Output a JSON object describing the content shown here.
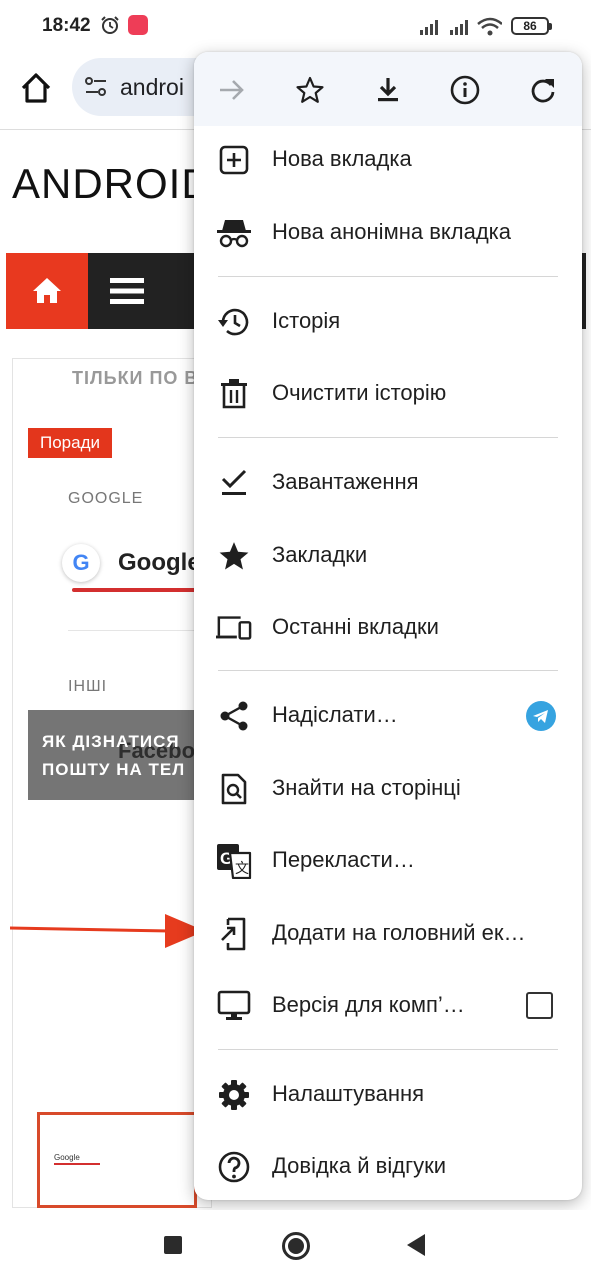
{
  "status_bar": {
    "time": "18:42",
    "battery": "86",
    "icons": [
      "alarm-icon",
      "app-notification-icon",
      "cellular-signal-icon",
      "cellular-signal-icon",
      "wifi-icon",
      "battery-icon"
    ]
  },
  "toolbar": {
    "url_text": "androi",
    "icons": [
      "home-icon",
      "site-settings-icon"
    ]
  },
  "page": {
    "heading": "ANDROID",
    "faded_text": "ТІЛЬКИ ПО В",
    "category_badge": "Поради",
    "google_section_label": "GOOGLE",
    "google_logo_letter": "G",
    "google_name": "Google",
    "other_section_label": "ІНШІ",
    "facebook_name": "Facebo",
    "overlay_title_line1": "ЯК ДІЗНАТИСЯ",
    "overlay_title_line2": "ПОШТУ НА ТЕЛ",
    "thumbnail_label": "Google",
    "nav_icons": [
      "home-icon",
      "hamburger-menu-icon"
    ]
  },
  "menu": {
    "action_row": [
      "forward-arrow-icon",
      "star-icon",
      "download-icon",
      "info-icon",
      "reload-icon"
    ],
    "items": [
      {
        "label": "Нова вкладка",
        "icon": "new-tab-icon"
      },
      {
        "label": "Нова анонімна вкладка",
        "icon": "incognito-icon"
      },
      {
        "label": "Історія",
        "icon": "history-icon"
      },
      {
        "label": "Очистити історію",
        "icon": "trash-icon"
      },
      {
        "label": "Завантаження",
        "icon": "download-check-icon"
      },
      {
        "label": "Закладки",
        "icon": "star-filled-icon"
      },
      {
        "label": "Останні вкладки",
        "icon": "devices-icon"
      },
      {
        "label": "Надіслати…",
        "icon": "share-icon",
        "trailing": "telegram-icon"
      },
      {
        "label": "Знайти на сторінці",
        "icon": "find-in-page-icon"
      },
      {
        "label": "Перекласти…",
        "icon": "translate-icon"
      },
      {
        "label": "Додати на головний ек…",
        "icon": "add-to-home-icon"
      },
      {
        "label": "Версія для комп’…",
        "icon": "desktop-icon",
        "trailing": "checkbox",
        "checked": false
      },
      {
        "label": "Налаштування",
        "icon": "settings-gear-icon"
      },
      {
        "label": "Довідка й відгуки",
        "icon": "help-icon"
      }
    ]
  },
  "nav_bar": {
    "buttons": [
      "recents-button",
      "home-button",
      "back-button"
    ]
  },
  "colors": {
    "accent_red": "#e8391f",
    "menu_header_bg": "#f3f6fb",
    "url_bar_bg": "#e9eef6",
    "telegram_blue": "#36a3e0",
    "annotation_arrow": "#e63b1e"
  }
}
